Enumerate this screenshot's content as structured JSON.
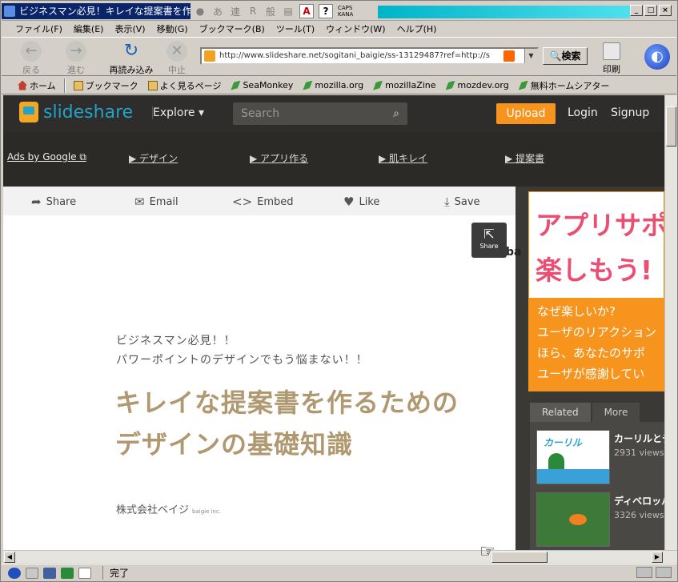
{
  "window": {
    "title": "ビジネスマン必見！キレイな提案書を作るため",
    "caps_label": "CAPS",
    "kana_label": "KANA",
    "ime_glyphs": [
      "あ",
      "連",
      "R",
      "般"
    ],
    "controls": {
      "minimize": "_",
      "maximize": "□",
      "close": "×"
    }
  },
  "menu": [
    "ファイル(F)",
    "編集(E)",
    "表示(V)",
    "移動(G)",
    "ブックマーク(B)",
    "ツール(T)",
    "ウィンドウ(W)",
    "ヘルプ(H)"
  ],
  "nav": {
    "back": "戻る",
    "forward": "進む",
    "reload": "再読み込み",
    "stop": "中止",
    "url": "http://www.slideshare.net/sogitani_baigie/ss-13129487?ref=http://s",
    "search_label": "検索",
    "print_label": "印刷"
  },
  "bookmarks": [
    "ホーム",
    "ブックマーク",
    "よく見るページ",
    "SeaMonkey",
    "mozilla.org",
    "mozillaZine",
    "mozdev.org",
    "無料ホームシアター"
  ],
  "site": {
    "logo": "slideshare",
    "explore": "Explore",
    "search_placeholder": "Search",
    "upload": "Upload",
    "login": "Login",
    "signup": "Signup"
  },
  "ads": {
    "by_google": "Ads by Google",
    "links": [
      "▶ デザイン",
      "▶ アプリ作る",
      "▶ 肌キレイ",
      "▶ 提案書"
    ]
  },
  "actions": [
    "Share",
    "Email",
    "Embed",
    "Like",
    "Save"
  ],
  "share_float": "Share",
  "slide": {
    "cut_text": "ba",
    "subtitle_1": "ビジネスマン必見！！",
    "subtitle_2": "パワーポイントのデザインでもう悩まない！！",
    "title_line1": "キレイな提案書を作るための",
    "title_line2": "デザインの基礎知識",
    "company": "株式会社ベイジ",
    "company_en": "baigie inc."
  },
  "side_ad": {
    "headline_1": "アプリサポ",
    "headline_2": "楽しもう!",
    "body": [
      "なぜ楽しいか?",
      "ユーザのリアクション",
      "ほら、あなたのサポ",
      "ユーザが感謝してい"
    ]
  },
  "related": {
    "tabs": [
      "Related",
      "More"
    ],
    "items": [
      {
        "title": "カーリルとデ",
        "views": "2931 views",
        "thumb_text": "カーリル"
      },
      {
        "title": "ディベロッパ",
        "views": "3326 views"
      }
    ]
  },
  "status": {
    "text": "完了"
  },
  "colors": {
    "accent": "#f7941d",
    "slide_title": "#b09870",
    "ad_pink": "#ea4f73",
    "titlebar": "#0a246a"
  }
}
